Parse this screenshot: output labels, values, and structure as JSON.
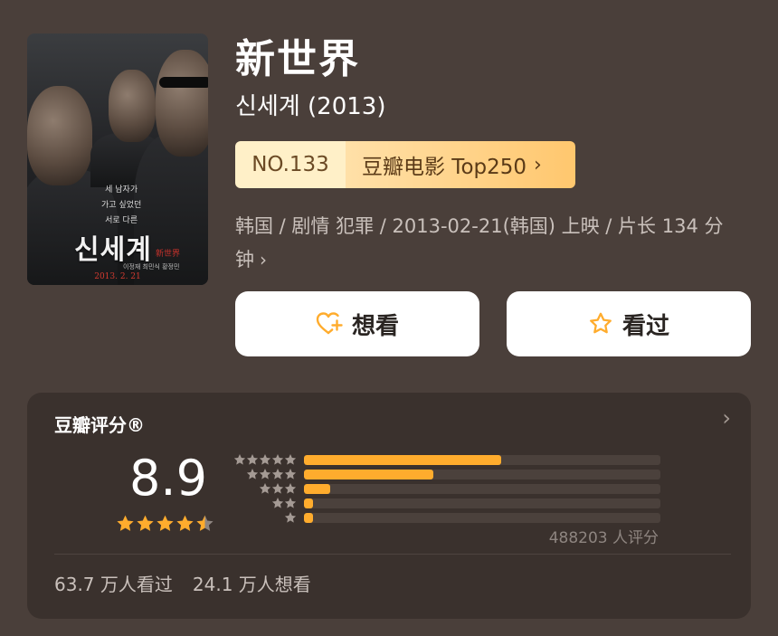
{
  "movie": {
    "title": "新世界",
    "subtitle": "신세계 (2013)",
    "poster": {
      "korean_title": "신세계",
      "tagline": [
        "세 남자가",
        "가고 싶었던",
        "서로 다른"
      ],
      "cn_mark": "新世界",
      "cast": "이정재 최민식 황정민",
      "date": "2013. 2. 21"
    }
  },
  "rank": {
    "number": "NO.133",
    "list_label": "豆瓣电影 Top250",
    "chevron": "›"
  },
  "meta": {
    "text": "韩国 / 剧情 犯罪 / 2013-02-21(韩国) 上映 / 片长 134 分钟",
    "chevron": "›"
  },
  "actions": {
    "want_label": "想看",
    "want_icon": "heart-plus-icon",
    "seen_label": "看过",
    "seen_icon": "star-outline-icon"
  },
  "rating": {
    "header": "豆瓣评分®",
    "more": "›",
    "score": "8.9",
    "stars": 4.5,
    "distribution": [
      {
        "stars": 5,
        "percent": 55.4
      },
      {
        "stars": 4,
        "percent": 36.3
      },
      {
        "stars": 3,
        "percent": 7.4
      },
      {
        "stars": 2,
        "percent": 0.6
      },
      {
        "stars": 1,
        "percent": 0.3
      }
    ],
    "count": "488203 人评分",
    "seen": "63.7 万人看过",
    "wish": "24.1 万人想看"
  },
  "colors": {
    "background": "#4a3f3a",
    "card": "#3a312d",
    "accent": "#ffac2d",
    "badge_light": "#fff0c8",
    "badge_gold": "#ffc76e"
  }
}
